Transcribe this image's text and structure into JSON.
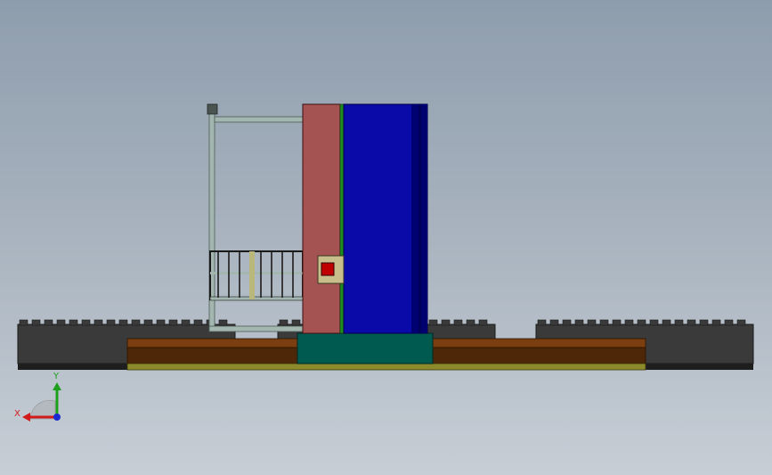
{
  "view": {
    "background": {
      "top": "#8e9dad",
      "bottom": "#c7ced6"
    }
  },
  "model": {
    "colors": {
      "rail_dark": "#3a3a3a",
      "rail_shadow": "#1e1e1e",
      "base_wood": "#7a3e10",
      "base_wood_dark": "#4e2708",
      "base_plate": "#8c8a2a",
      "pedestal": "#005a50",
      "frame_rail": "#a3b7b0",
      "column_side": "#a45252",
      "column_front": "#0a0aa8",
      "column_front_shade": "#000070",
      "stripe_green": "#1f8c1f",
      "control_box": "#c8be8c",
      "control_button": "#c00000",
      "cage": "#1a1a1a"
    }
  },
  "triad": {
    "x_label": "X",
    "y_label": "Y",
    "x_color": "#d21c1c",
    "y_color": "#1ea01e",
    "z_color": "#1a2ad0"
  }
}
